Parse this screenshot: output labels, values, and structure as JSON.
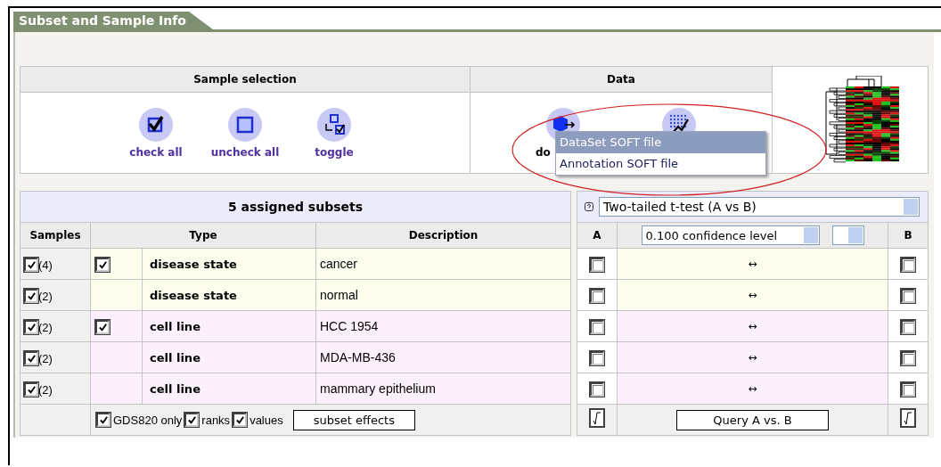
{
  "panel_tab": "Subset and Sample Info",
  "sample_selection": {
    "heading": "Sample selection",
    "actions": [
      {
        "kind": "check",
        "label": "check all"
      },
      {
        "kind": "uncheck",
        "label": "uncheck all"
      },
      {
        "kind": "toggle",
        "label": "toggle"
      }
    ]
  },
  "data": {
    "heading": "Data",
    "actions": [
      {
        "kind": "download",
        "label": "do"
      },
      {
        "kind": "analysis"
      }
    ]
  },
  "popup_menu": [
    {
      "label": "DataSet SOFT file",
      "selected": true
    },
    {
      "label": "Annotation SOFT file",
      "selected": false
    }
  ],
  "subsets": {
    "title": "5 assigned subsets",
    "columns": [
      "Samples",
      "Type",
      "Description"
    ],
    "rows": [
      {
        "checked": true,
        "count": "(4)",
        "type_box": true,
        "type_checked": true,
        "type": "disease state",
        "description": "cancer",
        "color": "#fdfdee"
      },
      {
        "checked": true,
        "count": "(2)",
        "type_box": false,
        "type": "disease state",
        "description": "normal",
        "color": "#fdfdee"
      },
      {
        "checked": true,
        "count": "(2)",
        "type_box": true,
        "type_checked": true,
        "type": "cell line",
        "description": "HCC 1954",
        "color": "#fdf0fd"
      },
      {
        "checked": true,
        "count": "(2)",
        "type_box": false,
        "type": "cell line",
        "description": "MDA-MB-436",
        "color": "#fdf0fd"
      },
      {
        "checked": true,
        "count": "(2)",
        "type_box": false,
        "type": "cell line",
        "description": "mammary epithelium",
        "color": "#fdf0fd"
      }
    ],
    "options": [
      {
        "label": "GDS820 only",
        "checked": true
      },
      {
        "label": "ranks",
        "checked": true
      },
      {
        "label": "values",
        "checked": true
      }
    ],
    "effects_button": "subset effects"
  },
  "comparison": {
    "test": "Two-tailed t-test (A vs B)",
    "col_a": "A",
    "confidence": "0.100 confidence level",
    "col_b": "B",
    "rows": [
      {
        "a_checked": false,
        "arrow": "↔",
        "b_checked": false
      },
      {
        "a_checked": false,
        "arrow": "↔",
        "b_checked": false
      },
      {
        "a_checked": false,
        "arrow": "↔",
        "b_checked": false
      },
      {
        "a_checked": false,
        "arrow": "↔",
        "b_checked": false
      },
      {
        "a_checked": false,
        "arrow": "↔",
        "b_checked": false
      }
    ],
    "query_button": "Query A vs. B"
  }
}
